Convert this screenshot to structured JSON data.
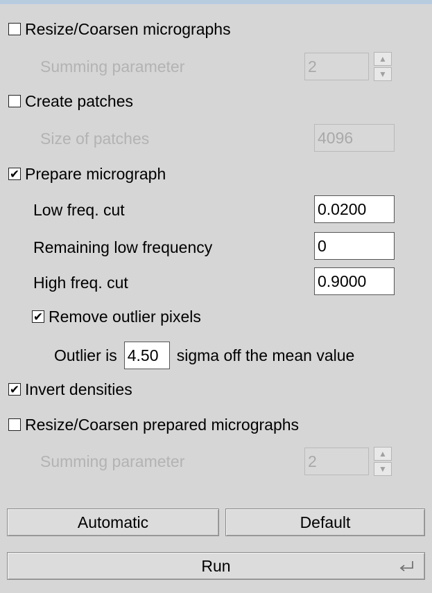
{
  "sections": {
    "resize": {
      "label": "Resize/Coarsen micrographs",
      "checked": false,
      "mark": "",
      "param_label": "Summing parameter",
      "param_value": "2"
    },
    "patches": {
      "label": "Create patches",
      "checked": false,
      "mark": "",
      "param_label": "Size of patches",
      "param_value": "4096"
    },
    "prepare": {
      "label": "Prepare micrograph",
      "checked": true,
      "mark": "✔",
      "low_cut_label": "Low freq. cut",
      "low_cut_value": "0.0200",
      "remaining_label": "Remaining low frequency",
      "remaining_value": "0",
      "high_cut_label": "High freq. cut",
      "high_cut_value": "0.9000"
    },
    "outlier": {
      "label": "Remove outlier pixels",
      "checked": true,
      "mark": "✔",
      "prefix": "Outlier is",
      "value": "4.50",
      "suffix": "sigma off the mean value"
    },
    "invert": {
      "label": "Invert densities",
      "checked": true,
      "mark": "✔"
    },
    "resize_prepared": {
      "label": "Resize/Coarsen prepared micrographs",
      "checked": false,
      "mark": "",
      "param_label": "Summing parameter",
      "param_value": "2"
    }
  },
  "buttons": {
    "automatic": "Automatic",
    "default": "Default",
    "run": "Run"
  },
  "icons": {
    "spin_up": "▲",
    "spin_down": "▼",
    "enter": "enter-icon"
  },
  "colors": {
    "panel": "#d6d6d6",
    "disabled_text": "#b3b3b3",
    "window_border": "#b8cce0"
  }
}
